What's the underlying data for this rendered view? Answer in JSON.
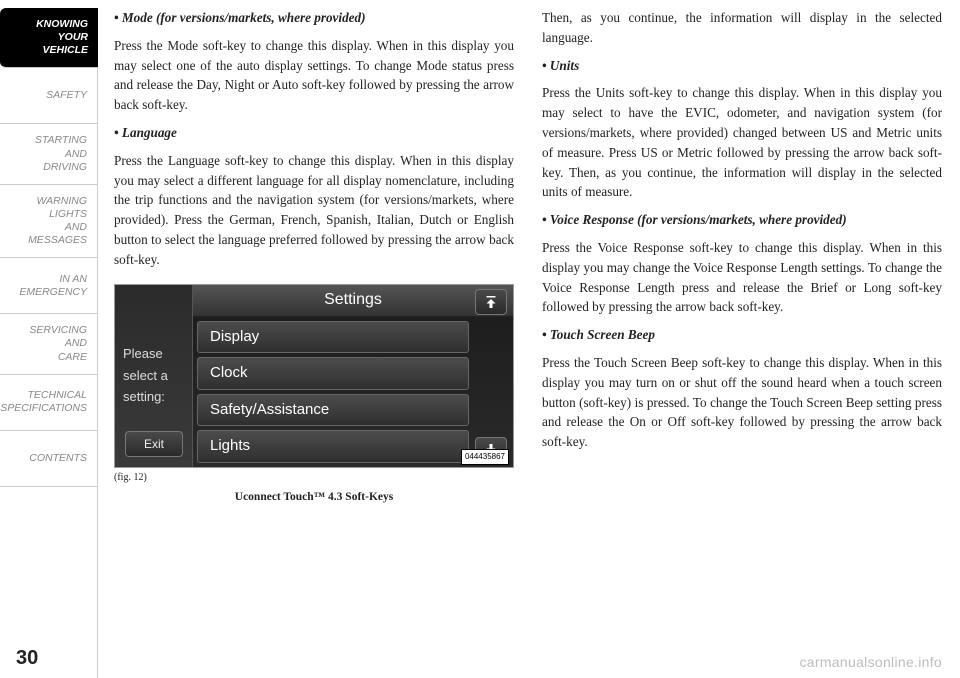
{
  "sidebar": {
    "items": [
      {
        "label": "KNOWING\nYOUR\nVEHICLE",
        "active": true
      },
      {
        "label": "SAFETY"
      },
      {
        "label": "STARTING\nAND\nDRIVING"
      },
      {
        "label": "WARNING\nLIGHTS\nAND\nMESSAGES"
      },
      {
        "label": "IN AN\nEMERGENCY"
      },
      {
        "label": "SERVICING\nAND\nCARE"
      },
      {
        "label": "TECHNICAL\nSPECIFICATIONS"
      },
      {
        "label": "CONTENTS"
      }
    ]
  },
  "left_col": {
    "bullet1": "•  Mode (for versions/markets, where provided)",
    "para1": "Press the Mode soft-key to change this display. When in this display you may select one of the auto display settings. To change Mode status press and release the Day, Night or Auto soft-key followed by pressing the arrow back soft-key.",
    "bullet2": "•  Language",
    "para2": "Press the Language soft-key to change this display. When in this display you may select a different language for all display nomenclature, including the trip functions and the navigation system (for versions/markets, where provided). Press the German, French, Spanish, Italian, Dutch or English button to select the language preferred followed by pressing the arrow back soft-key."
  },
  "right_col": {
    "para0": "Then, as you continue, the information will display in the selected language.",
    "bullet1": "•  Units",
    "para1": "Press the Units soft-key to change this display. When in this display you may select to have the EVIC, odometer, and navigation system (for versions/markets, where provided) changed between US and Metric units of measure. Press US or Metric followed by pressing the arrow back soft-key. Then, as you continue, the information will display in the selected units of measure.",
    "bullet2": "•  Voice Response (for versions/markets, where provided)",
    "para2": "Press the Voice Response soft-key to change this display. When in this display you may change the Voice Response Length settings. To change the Voice Response Length press and release the Brief or Long soft-key followed by pressing the arrow back soft-key.",
    "bullet3": "•  Touch Screen Beep",
    "para3": "Press the Touch Screen Beep soft-key to change this display. When in this display you may turn on or shut off the sound heard when a touch screen button (soft-key) is pressed. To change the Touch Screen Beep setting press and release the On or Off soft-key followed by pressing the arrow back soft-key."
  },
  "figure": {
    "side_text": [
      "Please",
      "select a",
      "setting:"
    ],
    "exit": "Exit",
    "header": "Settings",
    "rows": [
      "Display",
      "Clock",
      "Safety/Assistance",
      "Lights"
    ],
    "id": "044435867",
    "num": "(fig. 12)",
    "caption": "Uconnect Touch™ 4.3 Soft-Keys"
  },
  "page_number": "30",
  "watermark": "carmanualsonline.info"
}
